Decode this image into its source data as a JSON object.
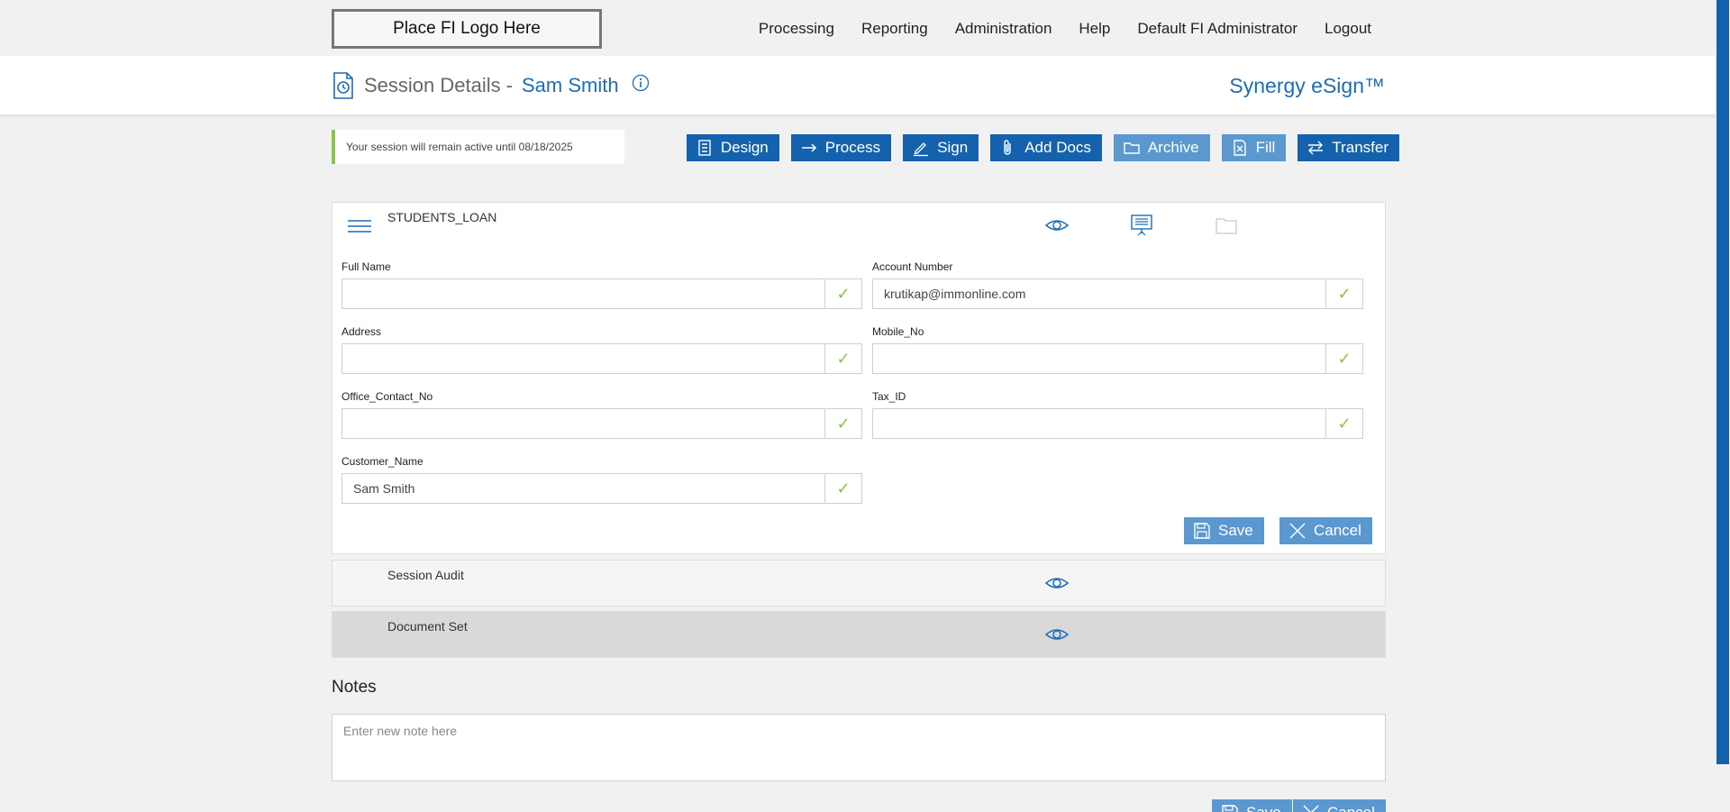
{
  "topbar": {
    "logo_text": "Place FI Logo Here",
    "nav": [
      "Processing",
      "Reporting",
      "Administration",
      "Help",
      "Default FI Administrator",
      "Logout"
    ]
  },
  "header": {
    "title_label": "Session Details",
    "title_dash": "-",
    "customer_name": "Sam Smith",
    "brand": "Synergy eSign™"
  },
  "notice": "Your session will remain active until 08/18/2025",
  "actions": [
    {
      "label": "Design",
      "icon": "list-icon",
      "style": "dark"
    },
    {
      "label": "Process",
      "icon": "arrow-right-icon",
      "style": "dark"
    },
    {
      "label": "Sign",
      "icon": "pen-icon",
      "style": "dark"
    },
    {
      "label": "Add Docs",
      "icon": "paperclip-icon",
      "style": "dark"
    },
    {
      "label": "Archive",
      "icon": "folder-icon",
      "style": "light"
    },
    {
      "label": "Fill",
      "icon": "file-x-icon",
      "style": "light"
    },
    {
      "label": "Transfer",
      "icon": "swap-icon",
      "style": "dark"
    }
  ],
  "panel": {
    "title": "STUDENTS_LOAN",
    "fields": {
      "full_name": {
        "label": "Full Name",
        "value": ""
      },
      "account_number": {
        "label": "Account Number",
        "value": "krutikap@immonline.com"
      },
      "address": {
        "label": "Address",
        "value": ""
      },
      "mobile_no": {
        "label": "Mobile_No",
        "value": ""
      },
      "office_contact_no": {
        "label": "Office_Contact_No",
        "value": ""
      },
      "tax_id": {
        "label": "Tax_ID",
        "value": ""
      },
      "customer_name": {
        "label": "Customer_Name",
        "value": "Sam Smith"
      }
    },
    "save_label": "Save",
    "cancel_label": "Cancel"
  },
  "sections": {
    "audit": "Session Audit",
    "docset": "Document Set"
  },
  "notes": {
    "heading": "Notes",
    "placeholder": "Enter new note here",
    "save_label": "Save",
    "cancel_label": "Cancel"
  },
  "colors": {
    "primary": "#1462ad",
    "primary_light": "#5b98cf",
    "accent_green": "#8bc34a",
    "brand_blue": "#1d6db4"
  }
}
